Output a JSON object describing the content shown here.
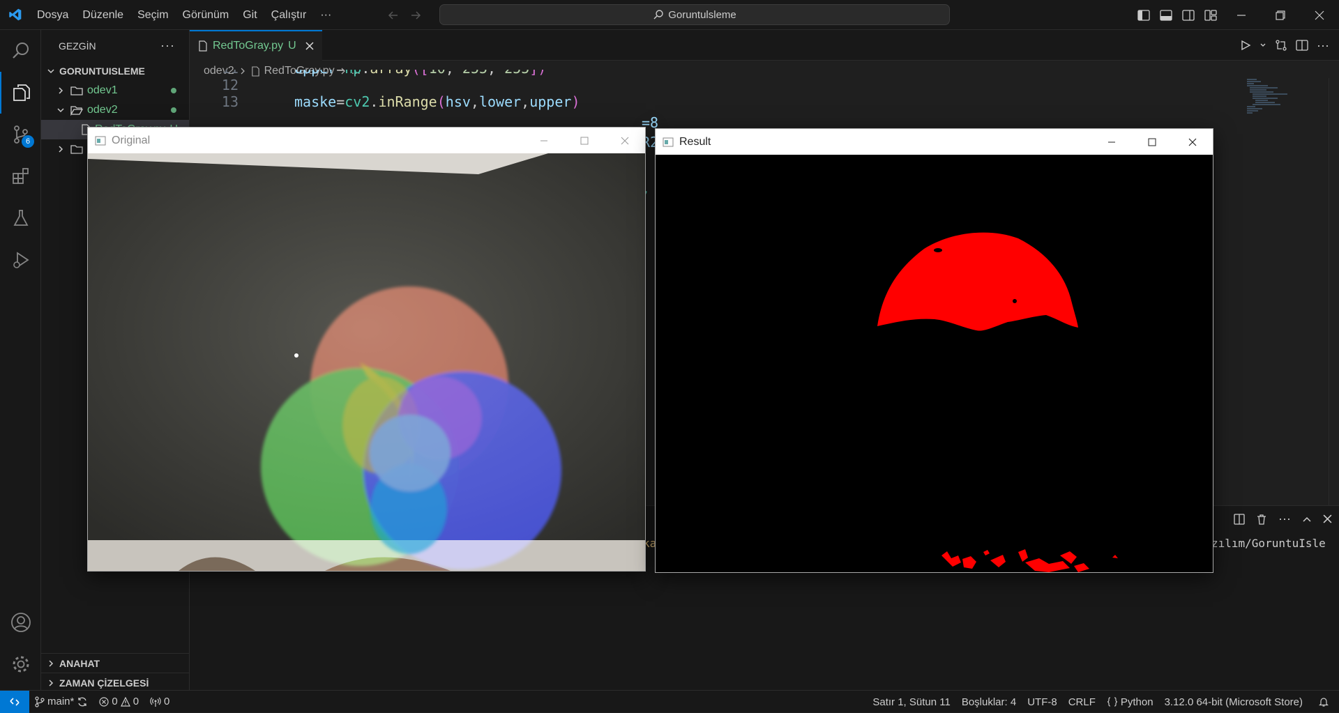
{
  "titlebar": {
    "menu": [
      "Dosya",
      "Düzenle",
      "Seçim",
      "Görünüm",
      "Git",
      "Çalıştır",
      "···"
    ],
    "search_text": "Goruntulsleme"
  },
  "activity": {
    "scm_badge": "6"
  },
  "sidebar": {
    "title": "GEZGİN",
    "root": "GORUNTUISLEME",
    "folders": [
      {
        "label": "odev1"
      },
      {
        "label": "odev2"
      }
    ],
    "file_label": "RedToGray.py",
    "file_status": "U",
    "outline": "ANAHAT",
    "timeline": "ZAMAN ÇİZELGESİ"
  },
  "editor": {
    "tab_label": "RedToGray.py",
    "tab_status": "U",
    "breadcrumb": [
      "odev2",
      "RedToGray.py",
      "..."
    ],
    "lines": [
      {
        "no": "11",
        "code": "upper=np.array([10, 255, 255])"
      },
      {
        "no": "12",
        "code": ""
      },
      {
        "no": "13",
        "code": "maske=cv2.inRange(hsv,lower,upper)"
      }
    ],
    "peek_text": [
      "=8",
      "R2",
      ", c"
    ]
  },
  "panel": {
    "left_fragment": "ka",
    "path_fragment": "zılım/GoruntuIsle"
  },
  "windows": {
    "original_title": "Original",
    "result_title": "Result"
  },
  "statusbar": {
    "branch": "main*",
    "errors": "0",
    "warnings": "0",
    "ports": "0",
    "position": "Satır 1, Sütun 11",
    "spaces": "Boşluklar: 4",
    "encoding": "UTF-8",
    "eol": "CRLF",
    "language": "Python",
    "interpreter": "3.12.0 64-bit (Microsoft Store)"
  },
  "colors": {
    "accent": "#0078d4",
    "untracked": "#73c991",
    "mask_red": "#ff0000"
  }
}
